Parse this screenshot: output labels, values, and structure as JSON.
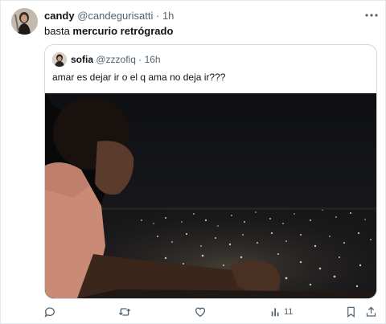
{
  "tweet": {
    "author_name": "candy",
    "author_handle": "@candegurisatti",
    "separator": "·",
    "time": "1h",
    "text_prefix": "basta ",
    "text_bold": "mercurio retrógrado",
    "more_icon": "more-horizontal-icon"
  },
  "quoted": {
    "author_name": "sofia",
    "author_handle": "@zzzofiq",
    "separator": "·",
    "time": "16h",
    "text": "amar es dejar ir o el q ama no deja ir???",
    "media_icon": "photo-icon"
  },
  "actions": {
    "reply_icon": "reply-icon",
    "retweet_icon": "retweet-icon",
    "like_icon": "like-icon",
    "views_icon": "views-icon",
    "views_count": "11",
    "bookmark_icon": "bookmark-icon",
    "share_icon": "share-icon"
  },
  "colors": {
    "text": "#0f1419",
    "muted": "#536471",
    "border": "#cfd9de"
  }
}
